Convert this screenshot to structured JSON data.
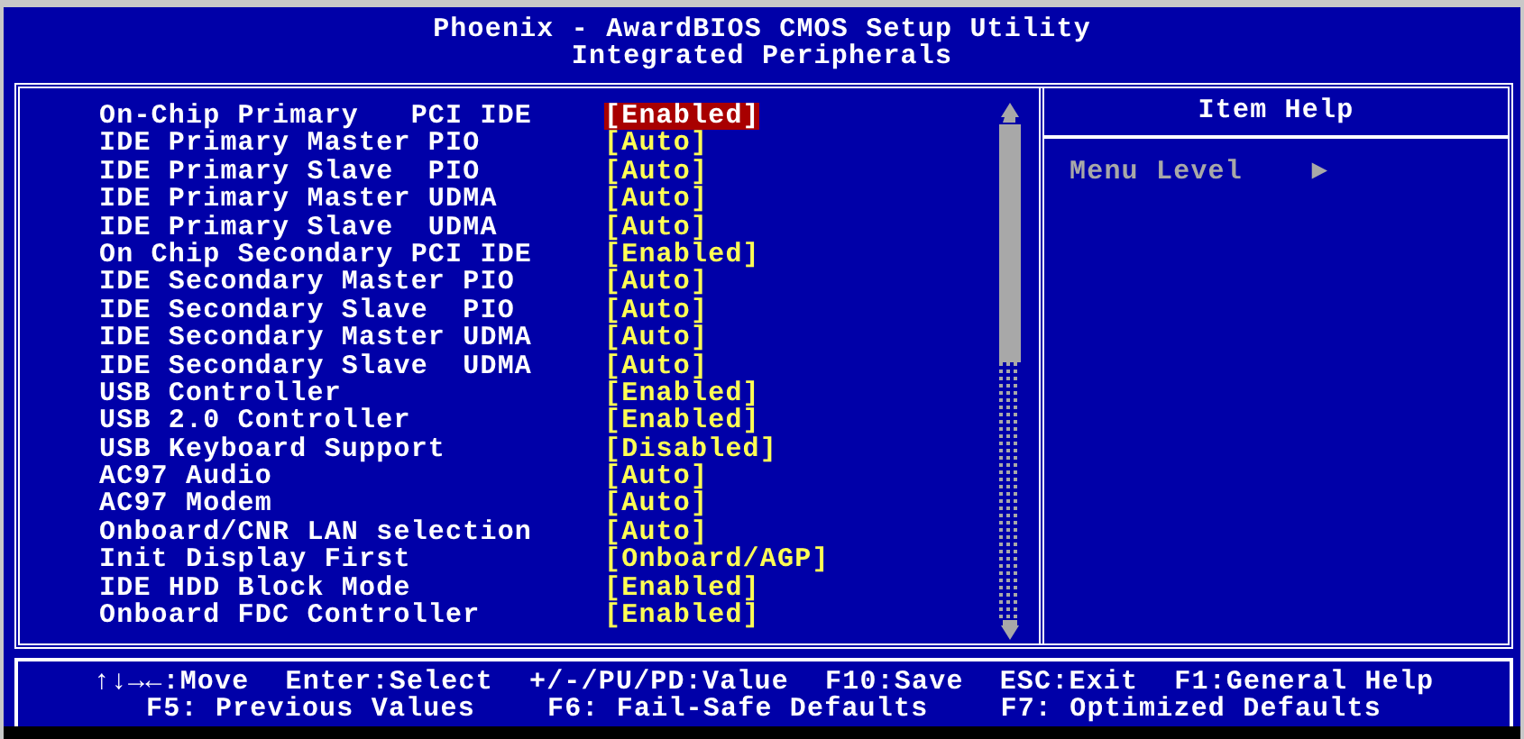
{
  "header": {
    "title": "Phoenix - AwardBIOS CMOS Setup Utility",
    "subtitle": "Integrated Peripherals"
  },
  "settings": [
    {
      "label": "On-Chip Primary   PCI IDE",
      "value": "[Enabled]",
      "selected": true
    },
    {
      "label": "IDE Primary Master PIO",
      "value": "[Auto]",
      "selected": false
    },
    {
      "label": "IDE Primary Slave  PIO",
      "value": "[Auto]",
      "selected": false
    },
    {
      "label": "IDE Primary Master UDMA",
      "value": "[Auto]",
      "selected": false
    },
    {
      "label": "IDE Primary Slave  UDMA",
      "value": "[Auto]",
      "selected": false
    },
    {
      "label": "On Chip Secondary PCI IDE",
      "value": "[Enabled]",
      "selected": false
    },
    {
      "label": "IDE Secondary Master PIO",
      "value": "[Auto]",
      "selected": false
    },
    {
      "label": "IDE Secondary Slave  PIO",
      "value": "[Auto]",
      "selected": false
    },
    {
      "label": "IDE Secondary Master UDMA",
      "value": "[Auto]",
      "selected": false
    },
    {
      "label": "IDE Secondary Slave  UDMA",
      "value": "[Auto]",
      "selected": false
    },
    {
      "label": "USB Controller",
      "value": "[Enabled]",
      "selected": false
    },
    {
      "label": "USB 2.0 Controller",
      "value": "[Enabled]",
      "selected": false
    },
    {
      "label": "USB Keyboard Support",
      "value": "[Disabled]",
      "selected": false
    },
    {
      "label": "AC97 Audio",
      "value": "[Auto]",
      "selected": false
    },
    {
      "label": "AC97 Modem",
      "value": "[Auto]",
      "selected": false
    },
    {
      "label": "Onboard/CNR LAN selection",
      "value": "[Auto]",
      "selected": false
    },
    {
      "label": "Init Display First",
      "value": "[Onboard/AGP]",
      "selected": false
    },
    {
      "label": "IDE HDD Block Mode",
      "value": "[Enabled]",
      "selected": false
    },
    {
      "label": "Onboard FDC Controller",
      "value": "[Enabled]",
      "selected": false
    }
  ],
  "item_help": {
    "title": "Item Help",
    "menu_level_label": "Menu Level",
    "menu_level_marker": "►"
  },
  "footer": {
    "line_1": [
      "↑↓→←:Move",
      "Enter:Select",
      "+/-/PU/PD:Value",
      "F10:Save",
      "ESC:Exit",
      "F1:General Help"
    ],
    "line_2": [
      "F5: Previous Values",
      "F6: Fail-Safe Defaults",
      "F7: Optimized Defaults"
    ]
  }
}
